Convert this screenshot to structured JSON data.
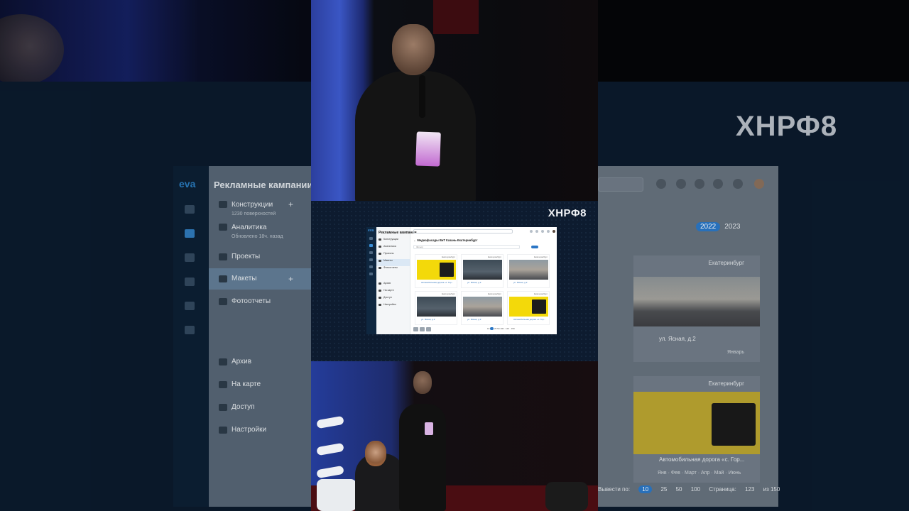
{
  "background": {
    "event_logo": "ХНРФ8",
    "app_logo": "eva",
    "sidebar": {
      "title": "Рекламные кампании",
      "items": [
        {
          "label": "Конструкции",
          "sub": "1230 поверхностей"
        },
        {
          "label": "Аналитика",
          "sub": "Обновлено 18ч. назад"
        },
        {
          "label": "Проекты",
          "sub": ""
        },
        {
          "label": "Макеты",
          "sub": ""
        },
        {
          "label": "Фотоотчеты",
          "sub": ""
        },
        {
          "label": "Архив",
          "sub": ""
        },
        {
          "label": "На карте",
          "sub": ""
        },
        {
          "label": "Доступ",
          "sub": ""
        },
        {
          "label": "Настройки",
          "sub": ""
        }
      ]
    },
    "years": [
      "2022",
      "2023"
    ],
    "cards": [
      {
        "city": "Екатеринбург",
        "caption": "ул. Ясная, д.2",
        "month": "Январь"
      },
      {
        "city": "Екатеринбург",
        "caption": "Автомобильная дорога «с. Гор..."
      }
    ],
    "months": [
      "Янв",
      "Фев",
      "Март",
      "Апр",
      "Май",
      "Июнь"
    ],
    "pager": {
      "show_label": "Вывести по:",
      "sizes": [
        "10",
        "25",
        "50",
        "100"
      ],
      "page_label": "Страница:",
      "page": "123",
      "of": "из 150"
    }
  },
  "slide": {
    "logo": "ХНРФ8",
    "screenshot": {
      "app_logo": "eva",
      "title": "Рекламные кампании",
      "breadcrumb": "← Медиафасады ВиТ Казань-Екатеринбург",
      "filter_placeholder": "Фильтр",
      "side_items": [
        "Конструкции",
        "Аналитика",
        "Проекты",
        "Макеты",
        "Фотоотчеты",
        "Архив",
        "На карте",
        "Доступ",
        "Настройки"
      ],
      "cards": [
        {
          "city": "Екатеринбург",
          "caption": "Автомобильная дорога «с. Гор..."
        },
        {
          "city": "Екатеринбург",
          "caption": "ул. Ясная, д.2"
        },
        {
          "city": "Екатеринбург",
          "caption": "ул. Ясная, д.2"
        },
        {
          "city": "Екатеринбург",
          "caption": "ул. Ясная, д.2"
        },
        {
          "city": "Екатеринбург",
          "caption": "ул. Ясная, д.2"
        },
        {
          "city": "Екатеринбург",
          "caption": "Автомобильная дорога «с. Гор..."
        }
      ]
    }
  }
}
